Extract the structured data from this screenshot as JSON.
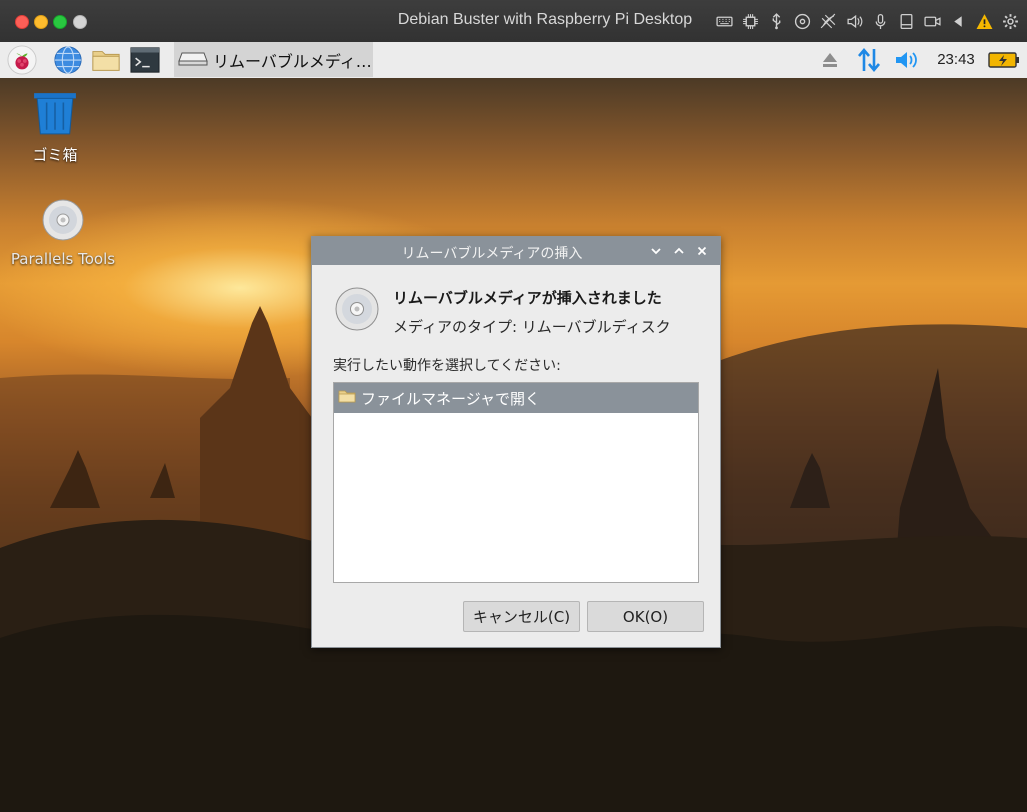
{
  "host_window": {
    "title": "Debian Buster with Raspberry Pi Desktop",
    "toolbar_icons": [
      "keyboard-icon",
      "cpu-icon",
      "usb-icon",
      "disc-icon",
      "network-icon",
      "speaker-icon",
      "microphone-icon",
      "drive-icon",
      "camera-icon",
      "play-icon",
      "warning-icon",
      "gear-icon"
    ]
  },
  "panel": {
    "launchers": [
      "raspberry-menu-icon",
      "web-browser-icon",
      "file-manager-icon",
      "terminal-icon"
    ],
    "task": {
      "label": "リムーバブルメディ…"
    },
    "clock": "23:43"
  },
  "desktop": {
    "icons": [
      {
        "label": "ゴミ箱",
        "icon": "trash-icon"
      },
      {
        "label": "Parallels Tools",
        "icon": "cd-icon"
      }
    ]
  },
  "dialog": {
    "title": "リムーバブルメディアの挿入",
    "heading": "リムーバブルメディアが挿入されました",
    "media_type": "メディアのタイプ:  リムーバブルディスク",
    "prompt": "実行したい動作を選択してください:",
    "actions": [
      {
        "label": "ファイルマネージャで開く",
        "selected": true
      }
    ],
    "cancel_label": "キャンセル(C)",
    "ok_label": "OK(O)"
  },
  "colors": {
    "selection": "#8a929a",
    "panel": "#ececec",
    "accent_blue": "#1e88e5"
  }
}
